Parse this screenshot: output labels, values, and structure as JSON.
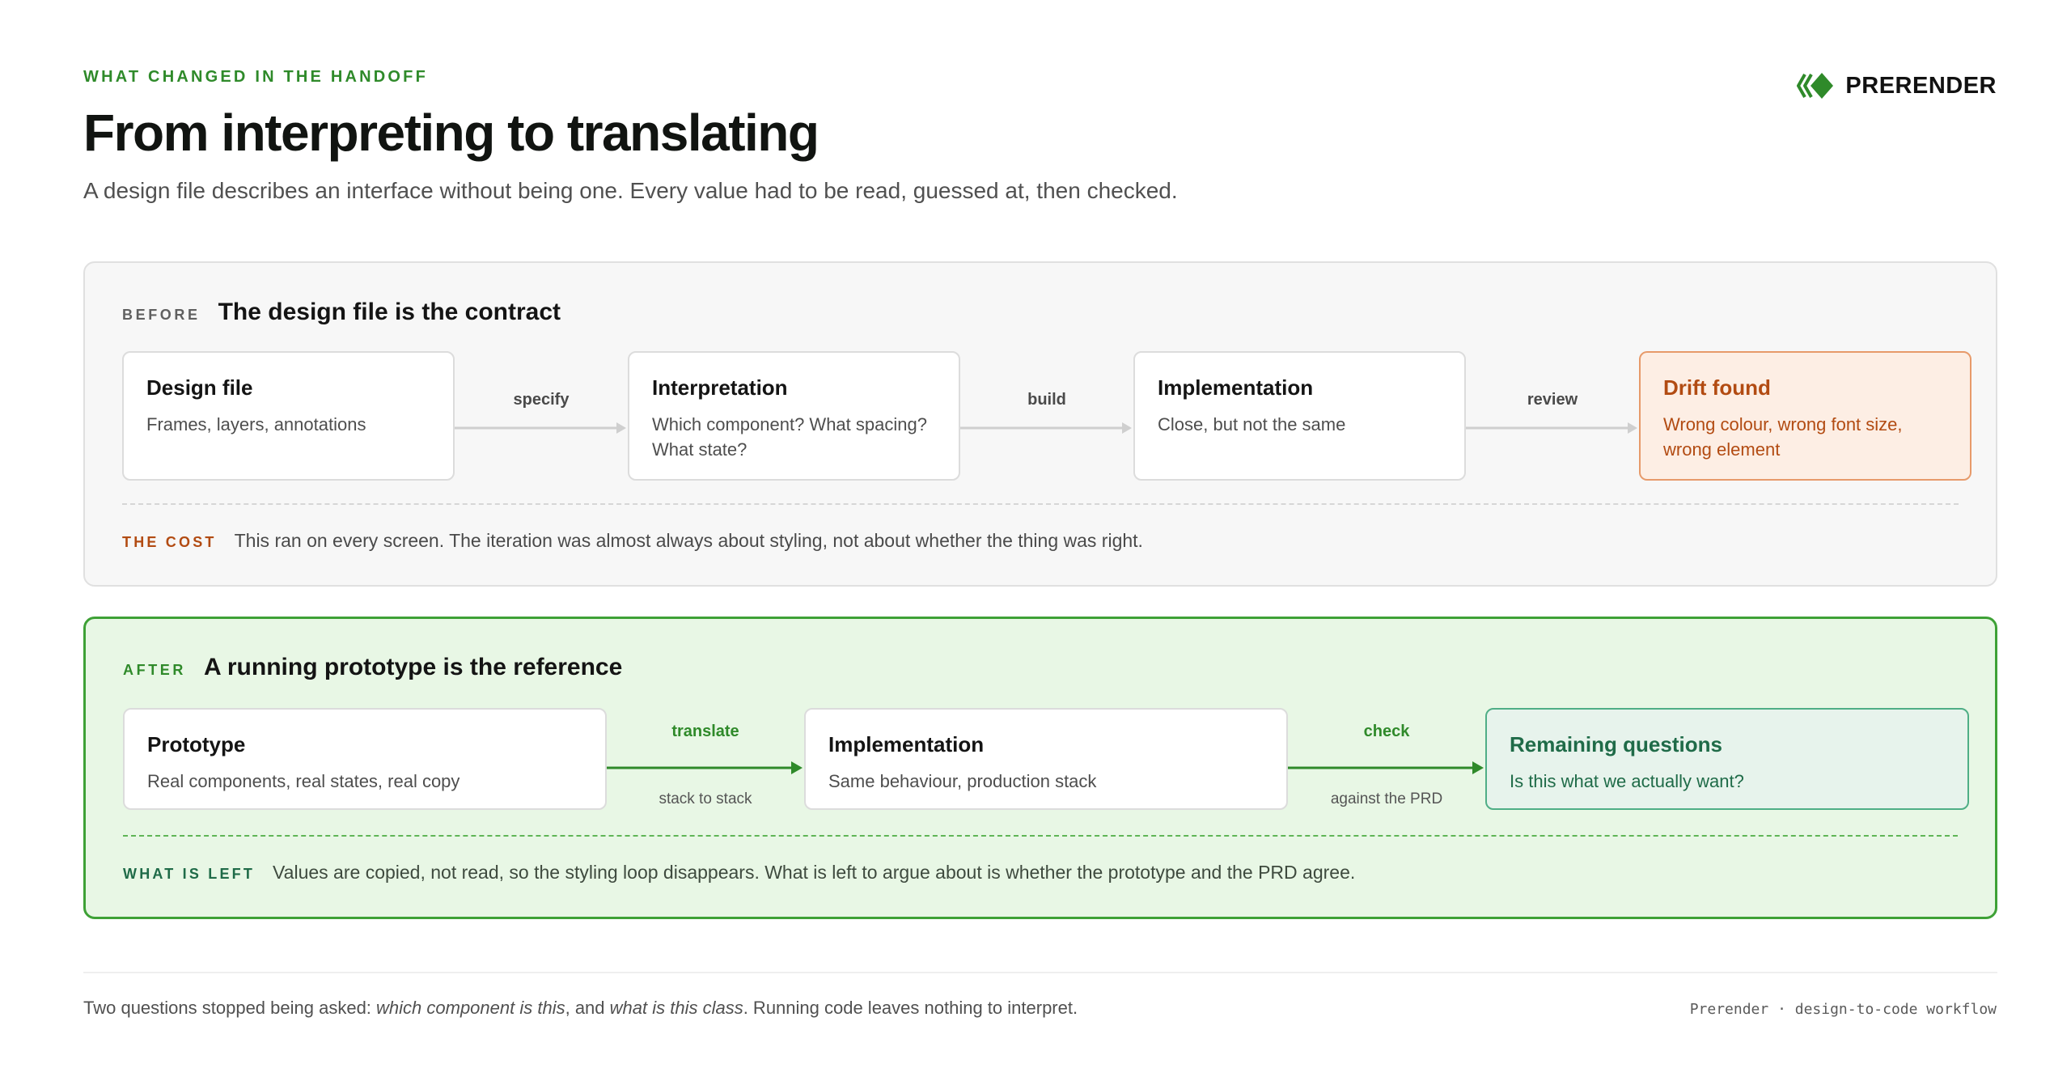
{
  "header": {
    "eyebrow": "WHAT CHANGED IN THE HANDOFF",
    "title": "From interpreting to translating",
    "subtitle": "A design file describes an interface without being one. Every value had to be read, guessed at, then checked."
  },
  "brand": {
    "name": "PRERENDER",
    "logo_icon": "diamond-chevrons-icon",
    "accent_color": "#2f8a2a"
  },
  "before": {
    "tag": "BEFORE",
    "title": "The design file is the contract",
    "steps": [
      {
        "title": "Design file",
        "desc": "Frames, layers, annotations"
      },
      {
        "title": "Interpretation",
        "desc": "Which component? What spacing? What state?"
      },
      {
        "title": "Implementation",
        "desc": "Close, but not the same"
      },
      {
        "title": "Drift found",
        "desc": "Wrong colour, wrong font size, wrong element"
      }
    ],
    "arrows": [
      "specify",
      "build",
      "review"
    ],
    "footer_tag": "THE COST",
    "footer_text": "This ran on every screen. The iteration was almost always about styling, not about whether the thing was right."
  },
  "after": {
    "tag": "AFTER",
    "title": "A running prototype is the reference",
    "steps": [
      {
        "title": "Prototype",
        "desc": "Real components, real states, real copy"
      },
      {
        "title": "Implementation",
        "desc": "Same behaviour, production stack"
      },
      {
        "title": "Remaining questions",
        "desc": "Is this what we actually want?"
      }
    ],
    "arrows": [
      {
        "label": "translate",
        "sub": "stack to stack"
      },
      {
        "label": "check",
        "sub": "against the PRD"
      }
    ],
    "footer_tag": "WHAT IS LEFT",
    "footer_text": "Values are copied, not read, so the styling loop disappears. What is left to argue about is whether the prototype and the PRD agree."
  },
  "footer": {
    "note_prefix": "Two questions stopped being asked: ",
    "note_q1": "which component is this",
    "note_mid": ", and ",
    "note_q2": "what is this class",
    "note_suffix": ". Running code leaves nothing to interpret.",
    "credit": "Prerender · design-to-code workflow"
  },
  "colors": {
    "drift": "#b24b12",
    "remaining": "#1f6b48",
    "after_border": "#3ea136"
  }
}
